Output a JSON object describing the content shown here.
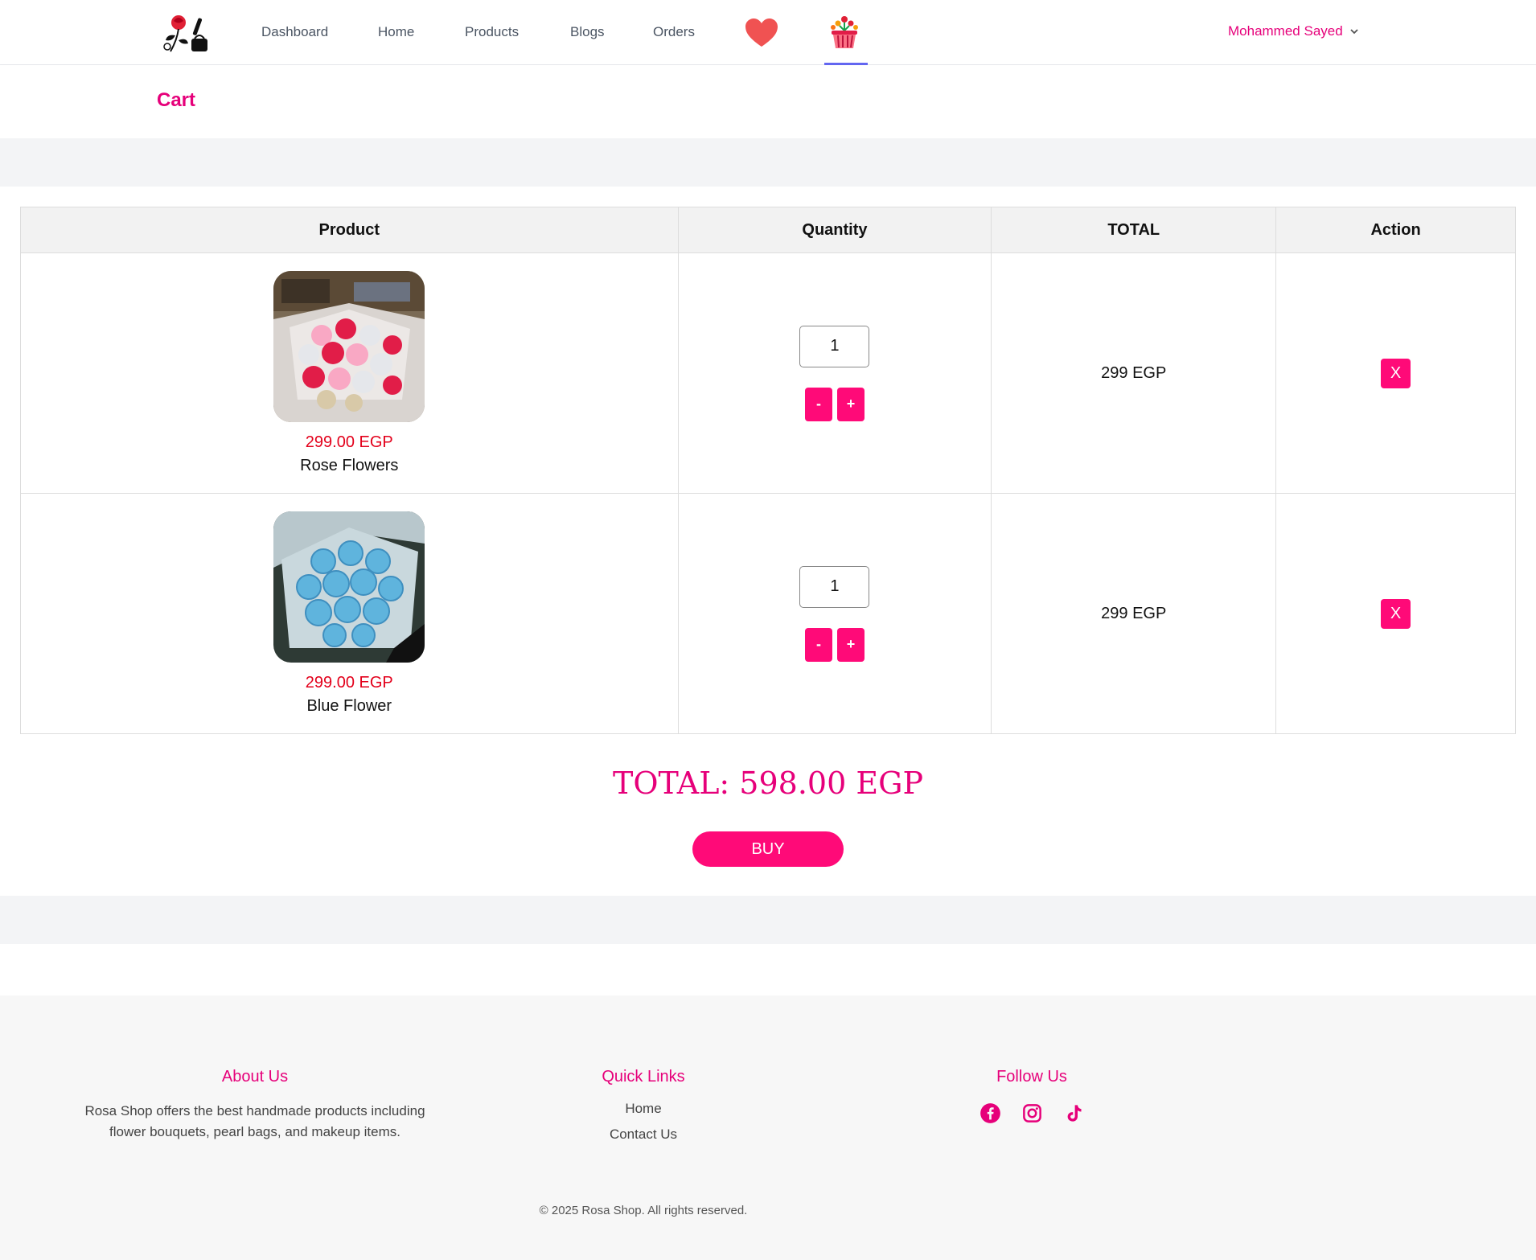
{
  "nav": {
    "links": [
      "Dashboard",
      "Home",
      "Products",
      "Blogs",
      "Orders"
    ],
    "user_name": "Mohammed Sayed",
    "icons": [
      "rosa-shop-logo-icon",
      "heart-icon",
      "flower-basket-icon",
      "chevron-down-icon"
    ]
  },
  "page": {
    "title": "Cart"
  },
  "table": {
    "headers": [
      "Product",
      "Quantity",
      "TOTAL",
      "Action"
    ],
    "rows": [
      {
        "price": "299.00 EGP",
        "name": "Rose Flowers",
        "quantity": "1",
        "line_total": "299 EGP",
        "minus": "-",
        "plus": "+",
        "remove": "X"
      },
      {
        "price": "299.00 EGP",
        "name": "Blue Flower",
        "quantity": "1",
        "line_total": "299 EGP",
        "minus": "-",
        "plus": "+",
        "remove": "X"
      }
    ]
  },
  "summary": {
    "total": "TOTAL: 598.00 EGP",
    "buy_label": "BUY"
  },
  "footer": {
    "about": {
      "title": "About Us",
      "text_line1": "Rosa Shop offers the best handmade products including",
      "text_line2": "flower bouquets, pearl bags, and makeup items."
    },
    "quick_links": {
      "title": "Quick Links",
      "links": [
        "Home",
        "Contact Us"
      ]
    },
    "follow": {
      "title": "Follow Us",
      "icons": [
        "facebook-icon",
        "instagram-icon",
        "tiktok-icon"
      ]
    },
    "copyright": "© 2025 Rosa Shop. All rights reserved."
  },
  "colors": {
    "brand": "#e6007a",
    "button": "#ff0a78",
    "price": "#e3001b",
    "active_underline": "#6366f1"
  }
}
